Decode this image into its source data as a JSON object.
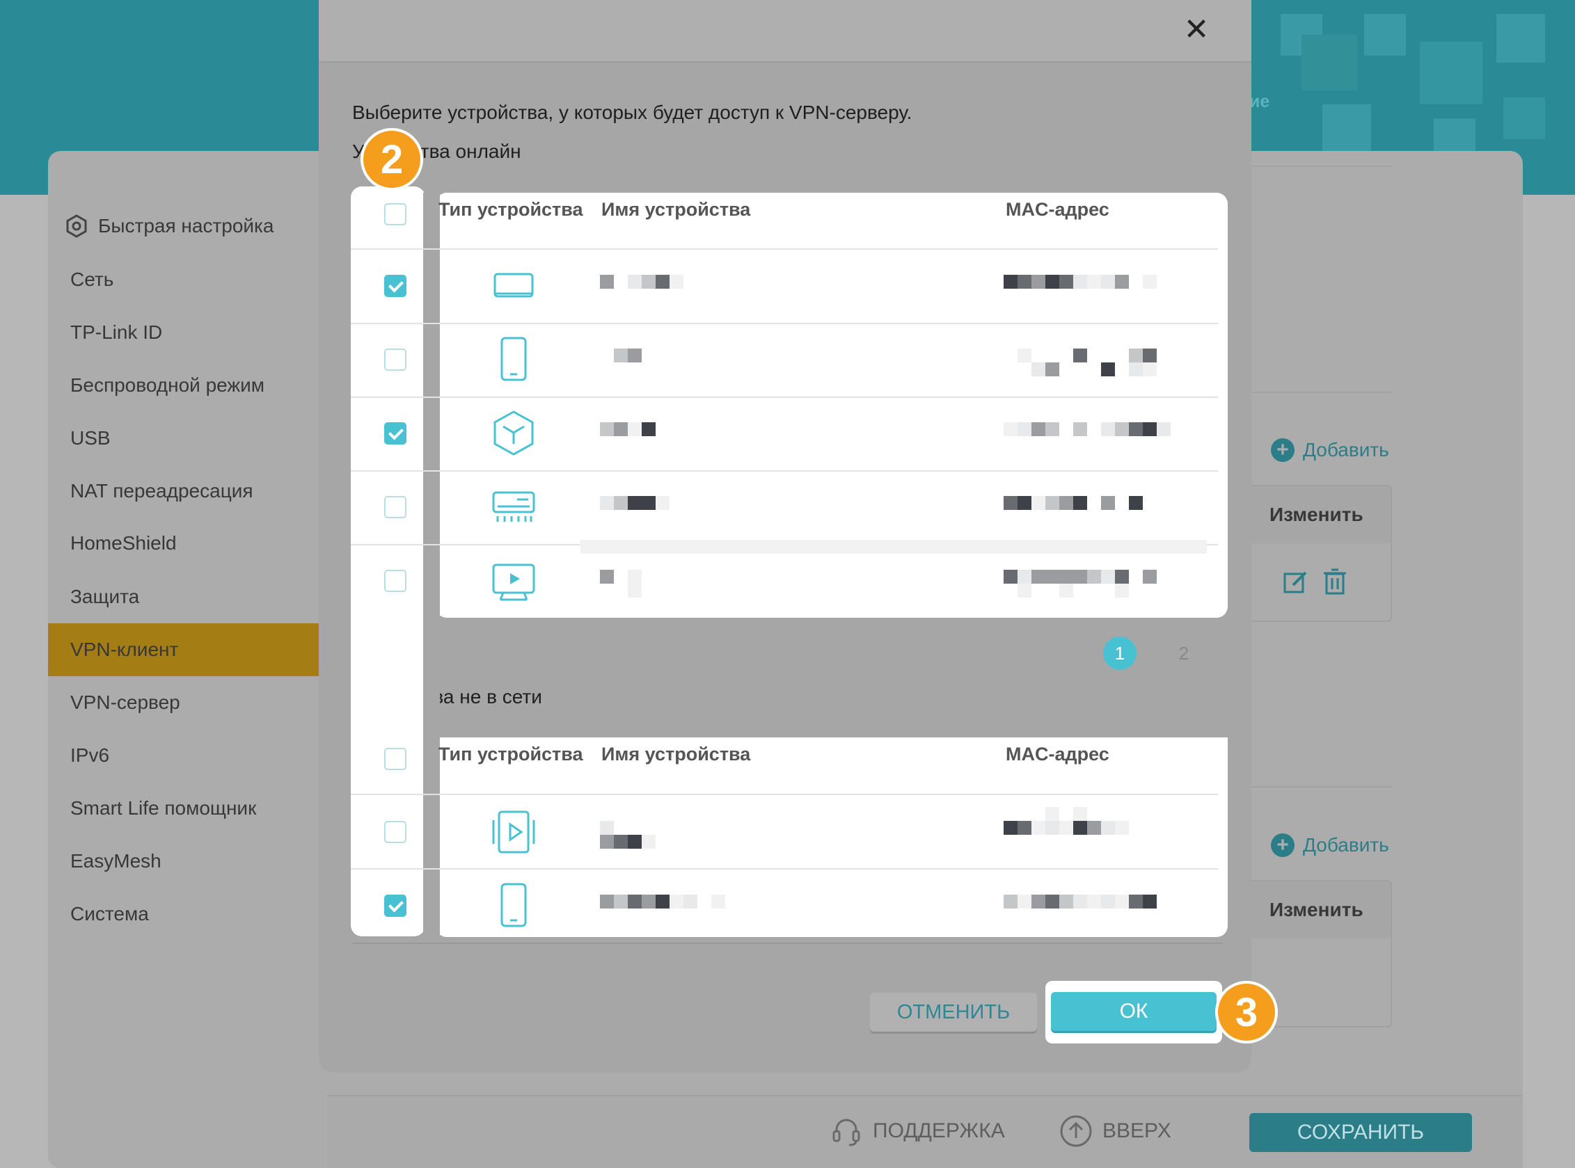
{
  "background": {
    "sidebar": [
      {
        "label": "Быстрая настройка",
        "icon": "gear-icon"
      },
      {
        "label": "Сеть"
      },
      {
        "label": "TP-Link ID"
      },
      {
        "label": "Беспроводной режим"
      },
      {
        "label": "USB"
      },
      {
        "label": "NAT переадресация"
      },
      {
        "label": "HomeShield"
      },
      {
        "label": "Защита"
      },
      {
        "label": "VPN-клиент",
        "active": true
      },
      {
        "label": "VPN-сервер"
      },
      {
        "label": "IPv6"
      },
      {
        "label": "Smart Life помощник"
      },
      {
        "label": "EasyMesh"
      },
      {
        "label": "Система"
      }
    ],
    "add_label": "Добавить",
    "edit_header": "Изменить",
    "header_fragment": "ие",
    "footer": {
      "support": "ПОДДЕРЖКА",
      "up": "ВВЕРХ",
      "save": "СОХРАНИТЬ"
    }
  },
  "modal": {
    "close_icon": "close-icon",
    "instruction": "Выберите устройства, у которых будет доступ к VPN-серверу.",
    "online_title_prefix": "У",
    "online_title_suffix": "тва онлайн",
    "offline_title": "Устройства не в сети",
    "columns": {
      "type": "Тип устройства",
      "name": "Имя устройства",
      "mac": "MAC-адрес"
    },
    "online_devices": [
      {
        "type_icon": "laptop-icon",
        "checked": true
      },
      {
        "type_icon": "phone-icon",
        "checked": false
      },
      {
        "type_icon": "cube-iot-icon",
        "checked": true
      },
      {
        "type_icon": "air-conditioner-icon",
        "checked": false
      },
      {
        "type_icon": "tv-icon",
        "checked": false
      }
    ],
    "offline_devices": [
      {
        "type_icon": "media-player-icon",
        "checked": false
      },
      {
        "type_icon": "phone-icon",
        "checked": true
      }
    ],
    "pagination": {
      "pages": [
        "1",
        "2"
      ],
      "current": "1"
    },
    "cancel_label": "ОТМЕНИТЬ",
    "ok_label": "ОК"
  },
  "annotations": {
    "step2": "2",
    "step3": "3",
    "color": "#f59d1d"
  },
  "colors": {
    "accent": "#48c2d2",
    "header": "#2a8a96",
    "active_item": "#a47e14"
  }
}
